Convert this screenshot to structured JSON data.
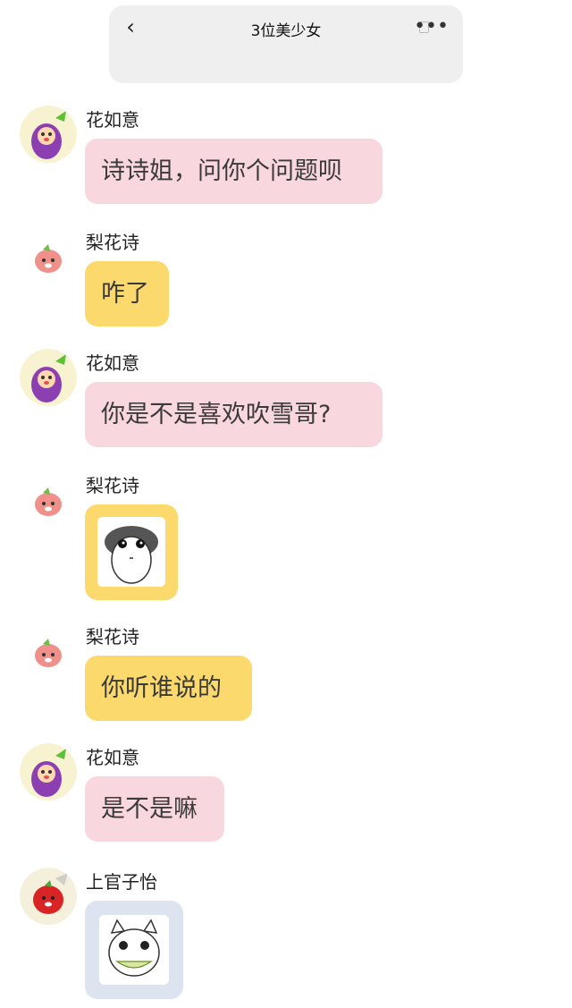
{
  "header": {
    "back_icon": "chevron-left-icon",
    "title": "3位美少女",
    "more_icon": "more-dots-icon"
  },
  "messages": [
    {
      "sender": "花如意",
      "avatar": "eggplant-avatar",
      "type": "text",
      "text": "诗诗姐，问你个问题呗",
      "color": "#f9d7df"
    },
    {
      "sender": "梨花诗",
      "avatar": "pink-character-avatar",
      "type": "text",
      "text": "咋了",
      "color": "#fbd96c"
    },
    {
      "sender": "花如意",
      "avatar": "eggplant-avatar",
      "type": "text",
      "text": "你是不是喜欢吹雪哥?",
      "color": "#f9d7df"
    },
    {
      "sender": "梨花诗",
      "avatar": "pink-character-avatar",
      "type": "sticker",
      "sticker": "staring-face-sticker",
      "color": "#fbd96c"
    },
    {
      "sender": "梨花诗",
      "avatar": "pink-character-avatar",
      "type": "text",
      "text": "你听谁说的",
      "color": "#fbd96c"
    },
    {
      "sender": "花如意",
      "avatar": "eggplant-avatar",
      "type": "text",
      "text": "是不是嘛",
      "color": "#f9d7df"
    },
    {
      "sender": "上官子怡",
      "avatar": "red-character-avatar",
      "type": "sticker",
      "sticker": "cat-eating-watermelon-sticker",
      "color": "#dde4ef"
    }
  ]
}
